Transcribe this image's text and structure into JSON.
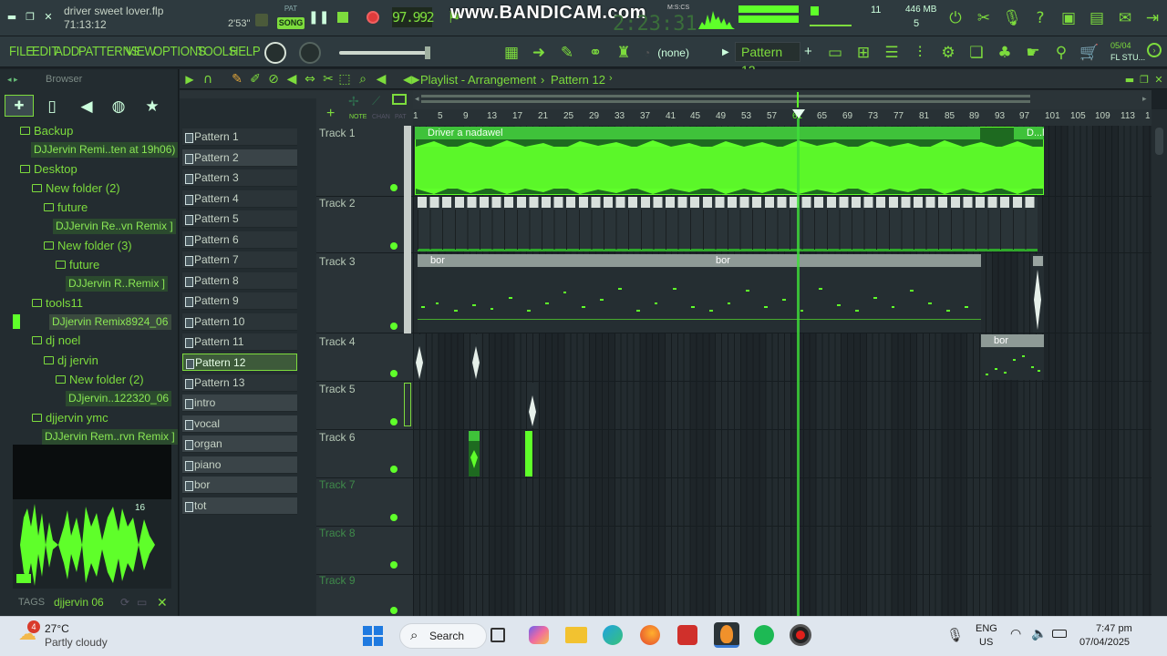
{
  "top": {
    "song_file": "driver sweet lover.flp",
    "song_time": "71:13:12",
    "time_small": "2'53\"",
    "pat_label": "PAT",
    "song_label": "SONG",
    "tempo": "97.992",
    "bandicam": "www.BANDICAM.com",
    "big_time": "2:23:31",
    "big_time_label": "M:S:CS",
    "cpu_value": "11",
    "memory": "446 MB",
    "poly": "5"
  },
  "menu": [
    "FILE",
    "EDIT",
    "ADD",
    "PATTERNS",
    "VIEW",
    "OPTIONS",
    "TOOLS",
    "HELP"
  ],
  "toolbar": {
    "snap_value": "(none)",
    "pattern_selector": "Pattern 12",
    "news_date": "05/04",
    "news_app": "FL STU..."
  },
  "browser": {
    "title": "Browser",
    "items": [
      {
        "label": "Backup",
        "type": "folder",
        "level": 0
      },
      {
        "label": "DJJervin Remi..ten at 19h06)",
        "type": "file",
        "level": 1
      },
      {
        "label": "Desktop",
        "type": "folder",
        "level": 0
      },
      {
        "label": "New folder (2)",
        "type": "folder",
        "level": 1
      },
      {
        "label": "future",
        "type": "folder",
        "level": 2
      },
      {
        "label": "DJJervin Re..vn Remix ]",
        "type": "file",
        "level": 3
      },
      {
        "label": "New folder (3)",
        "type": "folder",
        "level": 2
      },
      {
        "label": "future",
        "type": "folder",
        "level": 3
      },
      {
        "label": "DJJervin R..Remix ]",
        "type": "file",
        "level": 4
      },
      {
        "label": "tools11",
        "type": "folder",
        "level": 1
      },
      {
        "label": "DJjervin Remix8924_06",
        "type": "file",
        "level": 2
      },
      {
        "label": "dj noel",
        "type": "folder",
        "level": 1
      },
      {
        "label": "dj jervin",
        "type": "folder",
        "level": 2
      },
      {
        "label": "New folder (2)",
        "type": "folder",
        "level": 3
      },
      {
        "label": "DJjervin..122320_06",
        "type": "file",
        "level": 4
      },
      {
        "label": "djjervin ymc",
        "type": "folder",
        "level": 1
      },
      {
        "label": "DJJervin Rem..rvn Remix ]",
        "type": "file",
        "level": 2
      }
    ],
    "preview_counter": "16",
    "tags_label": "TAGS",
    "tags_value": "djjervin 06"
  },
  "playlist": {
    "title": "Playlist - Arrangement",
    "pattern": "Pattern 12",
    "ruler": [
      "1",
      "5",
      "9",
      "13",
      "17",
      "21",
      "25",
      "29",
      "33",
      "37",
      "41",
      "45",
      "49",
      "53",
      "57",
      "61",
      "65",
      "69",
      "73",
      "77",
      "81",
      "85",
      "89",
      "93",
      "97",
      "101",
      "105",
      "109",
      "113",
      "1"
    ],
    "playhead_bar": 61,
    "mini_tabs": [
      "NOTE",
      "CHAN",
      "PAT"
    ],
    "patterns": [
      "Pattern 1",
      "Pattern 2",
      "Pattern 3",
      "Pattern 4",
      "Pattern 5",
      "Pattern 6",
      "Pattern 7",
      "Pattern 8",
      "Pattern 9",
      "Pattern 10",
      "Pattern 11",
      "Pattern 12",
      "Pattern 13",
      "intro",
      "vocal",
      "organ",
      "piano",
      "bor",
      "tot"
    ],
    "selected_pattern": "Pattern 12",
    "tracks": [
      "Track 1",
      "Track 2",
      "Track 3",
      "Track 4",
      "Track 5",
      "Track 6",
      "Track 7",
      "Track 8",
      "Track 9"
    ],
    "clips": {
      "track1_main": "Driver a nadawel",
      "track1_tail": "D...l",
      "track3_a": "bor",
      "track3_b": "bor",
      "track4_a": "bor"
    }
  },
  "taskbar": {
    "weather_temp": "27°C",
    "weather_desc": "Partly cloudy",
    "weather_badge": "4",
    "search": "Search",
    "lang1": "ENG",
    "lang2": "US",
    "time": "7:47 pm",
    "date": "07/04/2025"
  },
  "colors": {
    "accent": "#7ddc3d",
    "bright": "#5fff2a",
    "clip_green": "#2f9a2b",
    "panel": "#2e3a3f"
  }
}
